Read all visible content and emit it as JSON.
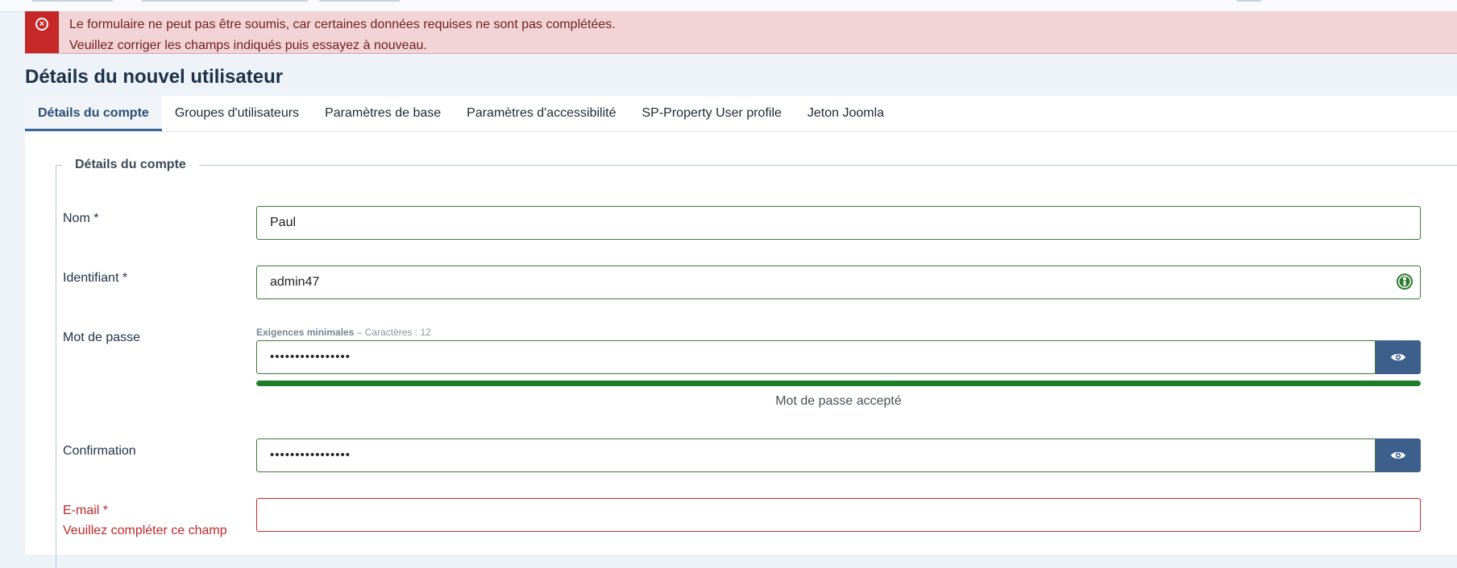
{
  "alert": {
    "line1": "Le formulaire ne peut pas être soumis, car certaines données requises ne sont pas complétées.",
    "line2": "Veuillez corriger les champs indiqués puis essayez à nouveau."
  },
  "page_title": "Détails du nouvel utilisateur",
  "tabs": [
    {
      "label": "Détails du compte"
    },
    {
      "label": "Groupes d'utilisateurs"
    },
    {
      "label": "Paramètres de base"
    },
    {
      "label": "Paramètres d'accessibilité"
    },
    {
      "label": "SP-Property User profile"
    },
    {
      "label": "Jeton Joomla"
    }
  ],
  "fieldset_legend": "Détails du compte",
  "fields": {
    "name": {
      "label": "Nom *",
      "value": "Paul"
    },
    "username": {
      "label": "Identifiant *",
      "value": "admin47"
    },
    "password": {
      "label": "Mot de passe",
      "hint_title": "Exigences minimales",
      "hint_rest": " – Caractères : 12",
      "value": "••••••••••••••••",
      "strength_text": "Mot de passe accepté",
      "strength_percent": 100
    },
    "confirm": {
      "label": "Confirmation",
      "value": "••••••••••••••••"
    },
    "email": {
      "label": "E-mail *",
      "error": "Veuillez compléter ce champ",
      "value": ""
    }
  },
  "colors": {
    "alert_accent": "#c52827",
    "valid_border": "#3f7a38",
    "error_border": "#c92a2a",
    "button": "#3d5f8c",
    "meter": "#1c7d2a"
  },
  "icons": {
    "alert": "circle-x-icon",
    "valid": "user-check-icon",
    "eye": "eye-icon"
  }
}
